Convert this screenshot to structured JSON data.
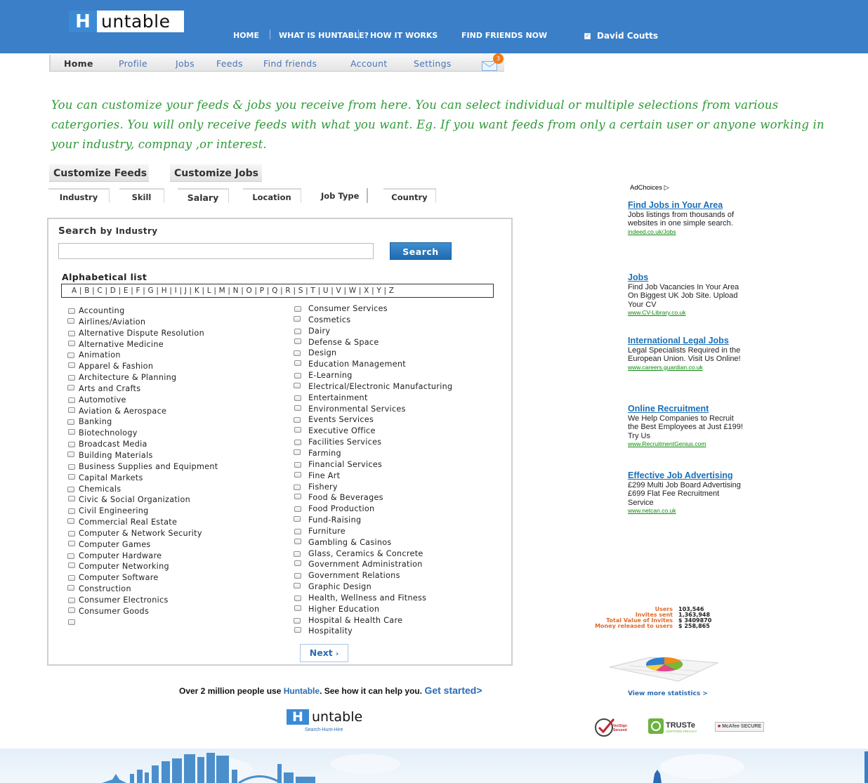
{
  "brand": {
    "logo_letter": "H",
    "logo_text": "untable",
    "tagline": "Search-Hunt-Hire"
  },
  "topnav": {
    "items": [
      "HOME",
      "WHAT IS HUNTABLE?",
      "HOW IT WORKS",
      "FIND FRIENDS NOW"
    ],
    "user_name": "David Coutts"
  },
  "subnav": {
    "items": [
      "Home",
      "Profile",
      "Jobs",
      "Feeds",
      "Find friends",
      "Account",
      "Settings"
    ],
    "mail_count": "3"
  },
  "note": "You can customize your feeds & jobs you receive from here. You can select individual or multiple selections from various catergories. You will only receive feeds with what you want. Eg. If you want feeds from only a certain  user or anyone  working in your industry, compnay ,or interest.",
  "tabs": [
    "Customize Feeds",
    "Customize Jobs"
  ],
  "filter_tabs": [
    "Industry",
    "Skill",
    "Salary",
    "Location",
    "Job Type",
    "Country"
  ],
  "search": {
    "label": "Search",
    "sublabel": "by Industry",
    "input_value": "",
    "button": "Search"
  },
  "alpha": {
    "label": "Alphabetical list",
    "letters": "A | B | C | D | E | F | G | H | I | J | K | L | M | N | O | P | Q | R | S | T | U | V | W | X | Y | Z"
  },
  "industries_left": [
    "Accounting",
    "Airlines/Aviation",
    "Alternative Dispute Resolution",
    "Alternative Medicine",
    "Animation",
    "Apparel & Fashion",
    "Architecture & Planning",
    "Arts and Crafts",
    "Automotive",
    "Aviation & Aerospace",
    "Banking",
    "Biotechnology",
    "Broadcast Media",
    "Building Materials",
    "Business Supplies and Equipment",
    "Capital Markets",
    "Chemicals",
    "Civic & Social Organization",
    "Civil Engineering",
    "Commercial Real Estate",
    "Computer & Network Security",
    "Computer Games",
    "Computer Hardware",
    "Computer Networking",
    "Computer Software",
    "Construction",
    "Consumer Electronics",
    "Consumer Goods"
  ],
  "industries_right": [
    "Consumer Services",
    "Cosmetics",
    "Dairy",
    "Defense & Space",
    "Design",
    "Education Management",
    "E-Learning",
    "Electrical/Electronic Manufacturing",
    "Entertainment",
    "Environmental Services",
    "Events Services",
    "Executive Office",
    "Facilities Services",
    "Farming",
    "Financial Services",
    "Fine Art",
    "Fishery",
    "Food & Beverages",
    "Food Production",
    "Fund-Raising",
    "Furniture",
    "Gambling & Casinos",
    "Glass, Ceramics & Concrete",
    "Government Administration",
    "Government Relations",
    "Graphic Design",
    "Health, Wellness and Fitness",
    "Higher Education",
    "Hospital & Health Care",
    "Hospitality"
  ],
  "next_button": "Next",
  "adchoices": "AdChoices",
  "ads": [
    {
      "title": "Find Jobs in Your Area",
      "desc": "Jobs listings from thousands of websites in one simple search.",
      "url": "indeed.co.uk/Jobs"
    },
    {
      "title": "Jobs",
      "desc": "Find Job Vacancies In Your Area On Biggest UK Job Site. Upload Your CV",
      "url": "www.CV-Library.co.uk"
    },
    {
      "title": "International Legal Jobs",
      "desc": "Legal Specialists Required in the European Union. Visit Us Online!",
      "url": "www.careers.guardian.co.uk"
    },
    {
      "title": "Online Recruitment",
      "desc": "We Help Companies to Recruit the Best Employees at Just £199! Try Us",
      "url": "www.RecruitmentGenius.com"
    },
    {
      "title": "Effective Job Advertising",
      "desc": "£299 Multi Job Board Advertising £699 Flat Fee Recruitment Service",
      "url": "www.netcan.co.uk"
    }
  ],
  "stats": [
    {
      "label": "Users",
      "value": "103,546"
    },
    {
      "label": "Invites sent",
      "value": "1,363,948"
    },
    {
      "label": "Total Value of Invites",
      "value": "$ 3409870"
    },
    {
      "label": "Money released to users",
      "value": "$ 258,865"
    }
  ],
  "stats_link": "View more statistics >",
  "promo": {
    "before": "Over 2 million people use ",
    "brand": "Huntable",
    "after": ". See how it can help you. ",
    "cta": "Get started>"
  },
  "trust_badges": [
    "VeriSign Secured",
    "TRUSTe",
    "CERTIFIED PRIVACY",
    "McAfee SECURE"
  ],
  "colors": {
    "header_blue": "#3a7fc8",
    "note_green": "#2f9a38",
    "link_blue": "#1a6fb8"
  }
}
